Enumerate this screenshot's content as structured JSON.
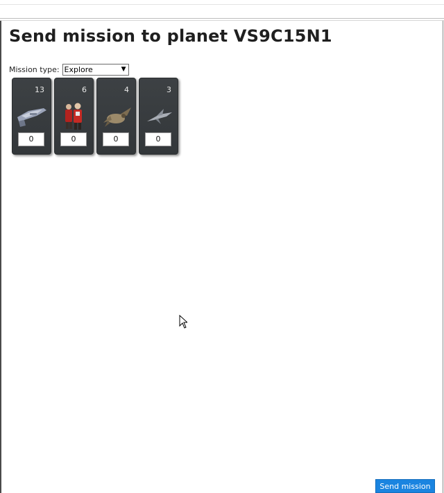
{
  "page": {
    "title": "Send mission to planet VS9C15N1"
  },
  "mission": {
    "label": "Mission type:",
    "selected": "Explore"
  },
  "units": [
    {
      "icon": "battleship-icon",
      "count": "13",
      "amount": "0"
    },
    {
      "icon": "crew-icon",
      "count": "6",
      "amount": "0"
    },
    {
      "icon": "beast-icon",
      "count": "4",
      "amount": "0"
    },
    {
      "icon": "fighter-icon",
      "count": "3",
      "amount": "0"
    }
  ],
  "actions": {
    "send_label": "Send mission"
  },
  "colors": {
    "card": "#3a3e41",
    "button": "#1a84e0"
  }
}
